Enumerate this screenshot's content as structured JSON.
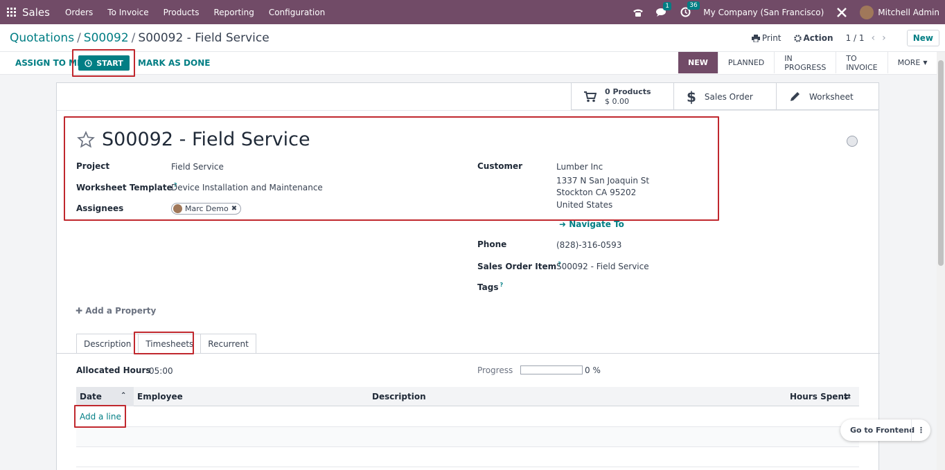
{
  "navbar": {
    "app": "Sales",
    "menus": [
      "Orders",
      "To Invoice",
      "Products",
      "Reporting",
      "Configuration"
    ],
    "messages_count": "1",
    "activities_count": "36",
    "company": "My Company (San Francisco)",
    "user": "Mitchell Admin"
  },
  "breadcrumb": {
    "root": "Quotations",
    "parent": "S00092",
    "current": "S00092 - Field Service"
  },
  "control": {
    "print": "Print",
    "action": "Action",
    "pager": "1 / 1",
    "new": "New"
  },
  "statusbar": {
    "assign": "ASSIGN TO ME",
    "start": "START",
    "mark_done": "MARK AS DONE",
    "stages": [
      "NEW",
      "PLANNED",
      "IN PROGRESS",
      "TO INVOICE",
      "MORE"
    ],
    "active_stage": "NEW"
  },
  "smart_buttons": {
    "products_count": "0 Products",
    "products_amount": "$ 0.00",
    "sales_order": "Sales Order",
    "worksheet": "Worksheet"
  },
  "form": {
    "title": "S00092 - Field Service",
    "project_label": "Project",
    "project": "Field Service",
    "worksheet_label": "Worksheet Template",
    "worksheet": "Device Installation and Maintenance",
    "assignees_label": "Assignees",
    "assignee": "Marc Demo",
    "customer_label": "Customer",
    "customer_name": "Lumber Inc",
    "address1": "1337 N San Joaquin St",
    "address2": "Stockton CA 95202",
    "address3": "United States",
    "navigate": "Navigate To",
    "phone_label": "Phone",
    "phone": "(828)-316-0593",
    "so_item_label": "Sales Order Item",
    "so_item": "S00092 - Field Service",
    "tags_label": "Tags",
    "add_property": "Add a Property"
  },
  "tabs": [
    "Description",
    "Timesheets",
    "Recurrent"
  ],
  "timesheets": {
    "allocated_label": "Allocated Hours",
    "allocated": "05:00",
    "progress_label": "Progress",
    "progress": "0 %",
    "progress_value": 0,
    "columns": [
      "Date",
      "Employee",
      "Description",
      "Hours Spent"
    ],
    "add_line": "Add a line"
  },
  "frontend": "Go to Frontend",
  "colors": {
    "brand": "#714b67",
    "accent": "#017e84",
    "annotation": "#c0272d"
  }
}
